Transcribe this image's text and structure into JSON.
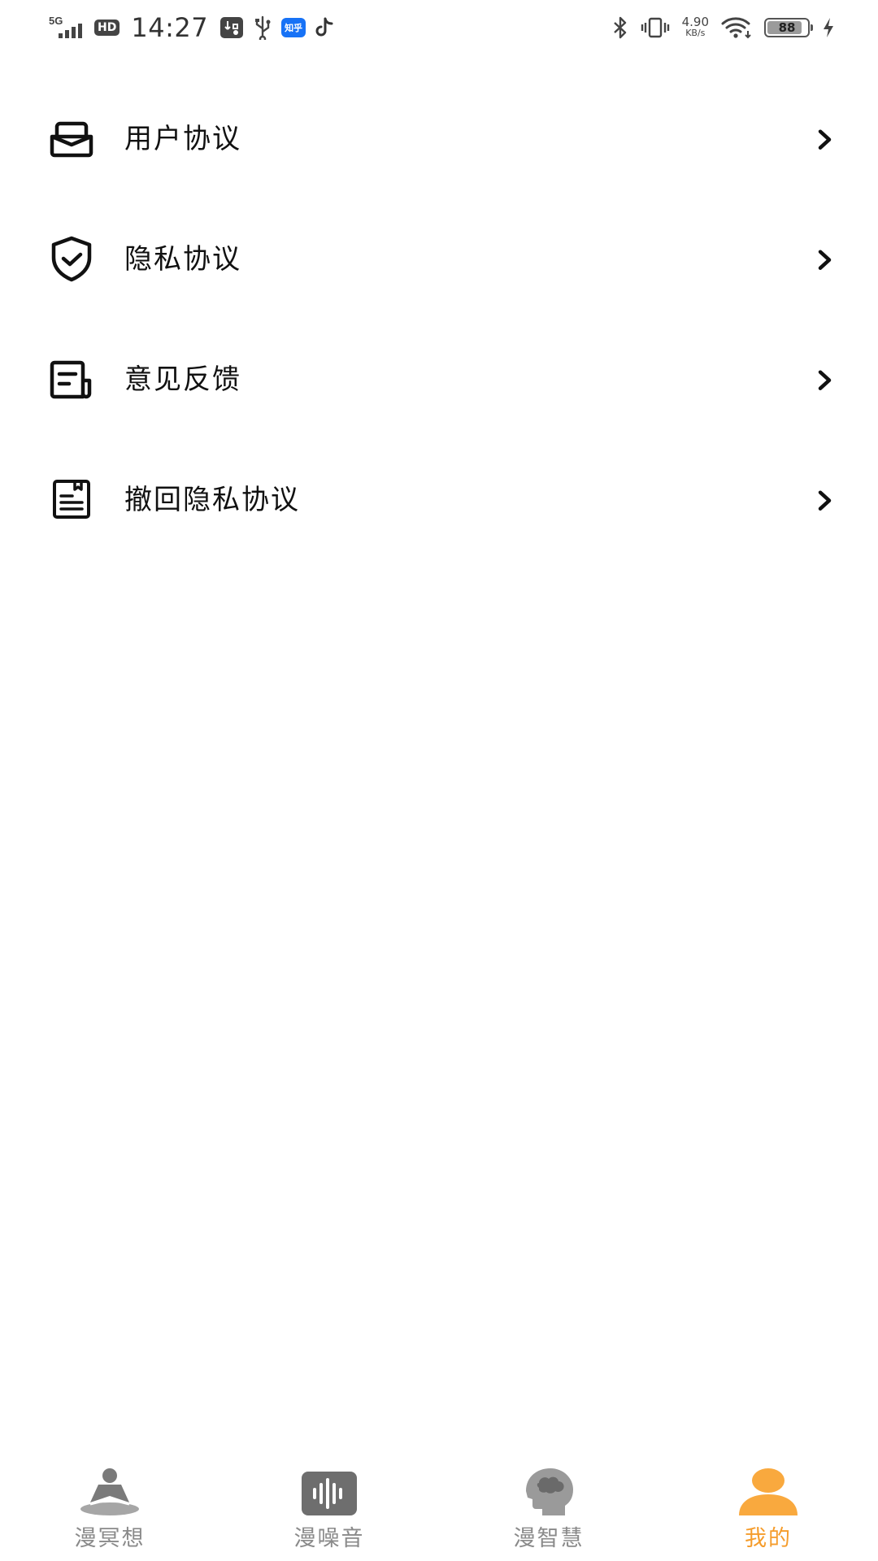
{
  "status_bar": {
    "network": "5G",
    "hd": "HD",
    "time": "14:27",
    "zhihu_label": "知乎",
    "speed_value": "4.90",
    "speed_unit": "KB/s",
    "battery_level": "88",
    "battery_fraction": 0.88
  },
  "settings": {
    "items": [
      {
        "label": "用户协议",
        "icon": "envelope-tray-icon"
      },
      {
        "label": "隐私协议",
        "icon": "shield-check-icon"
      },
      {
        "label": "意见反馈",
        "icon": "feedback-icon"
      },
      {
        "label": "撤回隐私协议",
        "icon": "document-icon"
      }
    ]
  },
  "tabs": [
    {
      "label": "漫冥想",
      "icon": "meditation-icon",
      "active": false
    },
    {
      "label": "漫噪音",
      "icon": "sound-wave-icon",
      "active": false
    },
    {
      "label": "漫智慧",
      "icon": "brain-head-icon",
      "active": false
    },
    {
      "label": "我的",
      "icon": "profile-icon",
      "active": true
    }
  ],
  "colors": {
    "active_tab": "#f59c2b",
    "inactive_tab": "#8a8a8a",
    "text": "#111111",
    "background": "#ffffff"
  }
}
